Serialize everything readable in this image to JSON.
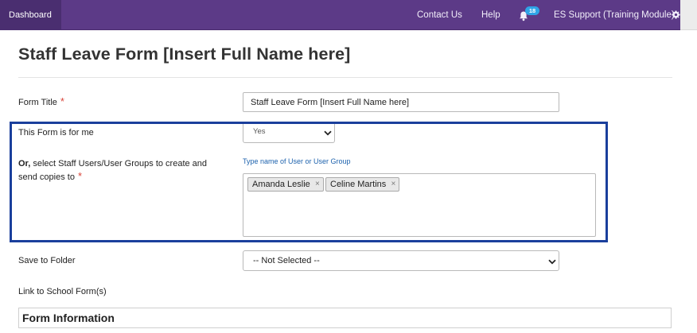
{
  "nav": {
    "dashboard": "Dashboard",
    "contact": "Contact Us",
    "help": "Help",
    "notifications_count": "18",
    "user": "ES Support (Training Module)",
    "bar_color": "#5c3a87"
  },
  "page": {
    "title": "Staff Leave Form [Insert Full Name here]"
  },
  "form": {
    "form_title": {
      "label": "Form Title",
      "required_mark": "*",
      "value": "Staff Leave Form [Insert Full Name here]"
    },
    "for_me": {
      "label": "This Form is for me",
      "value": "Yes"
    },
    "recipients": {
      "label_prefix": "Or,",
      "label_line1": " select Staff Users/User Groups to create and",
      "label_line2": "send copies to",
      "required_mark": "*",
      "hint": "Type name of User or User Group",
      "tokens": [
        "Amanda Leslie",
        "Celine Martins"
      ],
      "remove_glyph": "×"
    },
    "save_folder": {
      "label": "Save to Folder",
      "value": "-- Not Selected --"
    },
    "link_school": {
      "label": "Link to School Form(s)"
    }
  },
  "section": {
    "title": "Form Information"
  },
  "colors": {
    "highlight_border": "#1a3f9c",
    "required": "#d9453a",
    "link": "#1d62ad",
    "badge": "#2fa4e7"
  },
  "icons": [
    "bell-icon",
    "gear-icon",
    "chevron-down-icon"
  ]
}
